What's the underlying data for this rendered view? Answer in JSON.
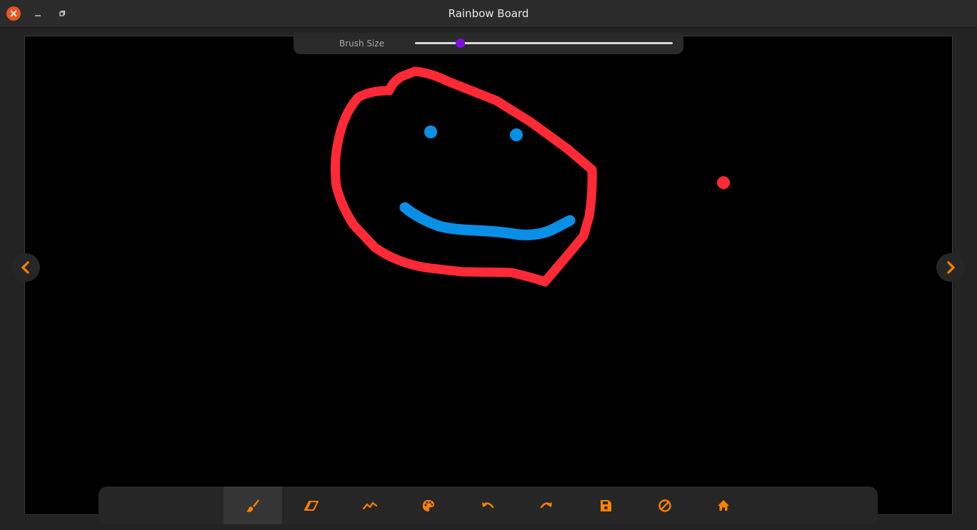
{
  "window": {
    "title": "Rainbow Board"
  },
  "brush": {
    "label": "Brush Size",
    "value_fraction": 0.175,
    "thumb_color": "#7d0fe6"
  },
  "colors": {
    "accent": "#ff8000",
    "close_button": "#e95420",
    "stroke_red": "#ff2a36",
    "stroke_blue": "#0a8fe6"
  },
  "navigation": {
    "prev_icon": "chevron-left-icon",
    "next_icon": "chevron-right-icon"
  },
  "toolbar": {
    "tools": [
      {
        "name": "brush",
        "icon": "brush-icon",
        "active": true
      },
      {
        "name": "eraser",
        "icon": "eraser-icon",
        "active": false
      },
      {
        "name": "line",
        "icon": "line-chart-icon",
        "active": false
      },
      {
        "name": "palette",
        "icon": "palette-icon",
        "active": false
      },
      {
        "name": "undo",
        "icon": "undo-icon",
        "active": false
      },
      {
        "name": "redo",
        "icon": "redo-icon",
        "active": false
      },
      {
        "name": "save",
        "icon": "save-icon",
        "active": false
      },
      {
        "name": "clear",
        "icon": "clear-icon",
        "active": false
      },
      {
        "name": "home",
        "icon": "home-icon",
        "active": false
      }
    ]
  }
}
